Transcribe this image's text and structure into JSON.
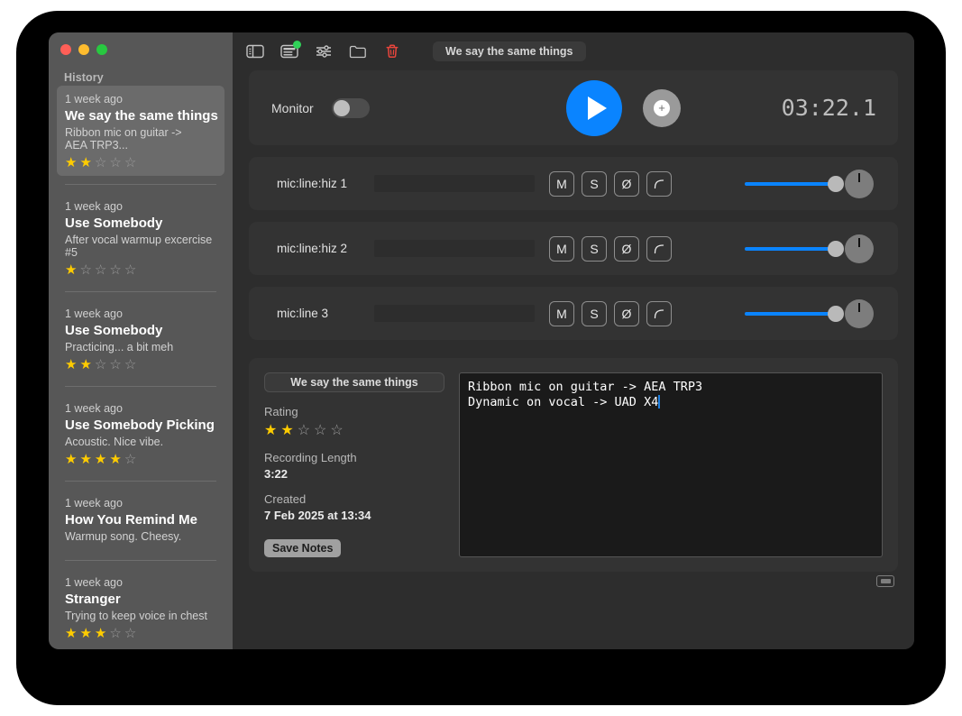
{
  "window": {
    "traffic_lights": [
      "close",
      "minimize",
      "zoom"
    ],
    "colors": {
      "accent_blue": "#0a84ff",
      "star_gold": "#ffcc00",
      "badge_green": "#30d158",
      "trash_red": "#e8453c",
      "sidebar_bg": "#575757",
      "panel_bg": "#333333",
      "window_bg": "#2d2d2d"
    }
  },
  "sidebar": {
    "header": "History",
    "items": [
      {
        "time": "1 week ago",
        "title": "We say the same things",
        "note_line1": "Ribbon mic on guitar ->",
        "note_line2": "AEA TRP3...",
        "rating": 2,
        "selected": true
      },
      {
        "time": "1 week ago",
        "title": "Use Somebody",
        "note_line1": "After vocal warmup excercise",
        "note_line2": "#5",
        "rating": 1,
        "selected": false
      },
      {
        "time": "1 week ago",
        "title": "Use Somebody",
        "note_line1": "Practicing... a bit meh",
        "note_line2": "",
        "rating": 2,
        "selected": false
      },
      {
        "time": "1 week ago",
        "title": "Use Somebody Picking",
        "note_line1": "Acoustic. Nice vibe.",
        "note_line2": "",
        "rating": 4,
        "selected": false
      },
      {
        "time": "1 week ago",
        "title": "How You Remind Me",
        "note_line1": "Warmup song. Cheesy.",
        "note_line2": "",
        "rating": 0,
        "selected": false
      },
      {
        "time": "1 week ago",
        "title": "Stranger",
        "note_line1": "Trying to keep voice in chest",
        "note_line2": "",
        "rating": 3,
        "selected": false
      }
    ]
  },
  "toolbar": {
    "icons": [
      "sidebar-toggle-icon",
      "notes-icon",
      "sliders-icon",
      "folder-icon",
      "trash-icon"
    ],
    "title_field_value": "We say the same things"
  },
  "transport": {
    "monitor_label": "Monitor",
    "monitor_on": false,
    "play_label": "play",
    "record_label": "record",
    "timer": "03:22.1"
  },
  "channels": [
    {
      "name": "mic:line:hiz 1",
      "buttons": [
        "M",
        "S",
        "Ø",
        "highpass"
      ],
      "level": 0,
      "fader": 100,
      "pan": 0
    },
    {
      "name": "mic:line:hiz 2",
      "buttons": [
        "M",
        "S",
        "Ø",
        "highpass"
      ],
      "level": 0,
      "fader": 100,
      "pan": 0
    },
    {
      "name": "mic:line 3",
      "buttons": [
        "M",
        "S",
        "Ø",
        "highpass"
      ],
      "level": 0,
      "fader": 100,
      "pan": 0
    }
  ],
  "notes_panel": {
    "title_value": "We say the same things",
    "rating_label": "Rating",
    "rating": 2,
    "length_label": "Recording Length",
    "length_value": "3:22",
    "created_label": "Created",
    "created_value": "7 Feb 2025 at 13:34",
    "save_label": "Save Notes",
    "notes_line1": "Ribbon mic on guitar -> AEA TRP3",
    "notes_line2": "Dynamic on vocal -> UAD X4"
  },
  "bottom_bar": {
    "keyboard_icon": "keyboard-icon"
  }
}
